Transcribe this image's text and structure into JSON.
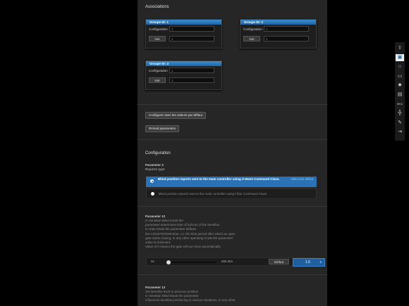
{
  "associations": {
    "title": "Associations",
    "groups": [
      {
        "header": "Groupe ID: 1",
        "config_label": "Configuration",
        "config_value": "1",
        "btn_label": "Voir",
        "btn_value": "1"
      },
      {
        "header": "Groupe ID: 2",
        "config_label": "Configuration",
        "config_value": "1",
        "btn_label": "Voir",
        "btn_value": "1"
      },
      {
        "header": "Groupe ID: 3",
        "config_label": "Configuration",
        "config_value": "1",
        "btn_label": "Voir",
        "btn_value": "1"
      }
    ]
  },
  "actions": {
    "configure_default": "Configurer avec les valeurs par défaut",
    "reload": "Reload parameters"
  },
  "configuration": {
    "title": "Configuration",
    "param3": {
      "title": "Parameter 3",
      "subtitle": "Reports type",
      "options": [
        {
          "label": "Blind position reports sent to the main controller using Z-Wave Command Class.",
          "selected": true,
          "default_note": "Valeur par défaut"
        },
        {
          "label": "Blind position reports sent to the main controller using Fibar Command Class.",
          "selected": false
        }
      ]
    },
    "param12": {
      "title": "Parameter 12",
      "lines": [
        "In Venetian Blind mode the",
        "parameter determines time of full turn of the lamellas.",
        "In Gate Mode the parameter defines",
        "the COUNTDOWN time, i.e. the time period after which an open",
        "gate starts closing. In any other operating mode the parameter",
        "value is irrelevant.",
        "Value of 0 means the gate will not close automatically."
      ],
      "slider": {
        "min_label": "0s",
        "max_label": "655.35s",
        "value_fraction": 0,
        "default_btn": "Défaut",
        "value": "1.5",
        "unit": "s"
      }
    },
    "param13": {
      "title": "Parameter 13",
      "lines": [
        "Set lamellas back to previous position",
        "In Venetian Blind Mode the parameter",
        "influences lamellas positioning in various situations. In any other"
      ]
    }
  },
  "toolbar": {
    "items": [
      {
        "name": "up-arrow-icon",
        "glyph": "⇧",
        "active": false
      },
      {
        "name": "save-icon",
        "glyph": "▣",
        "active": true
      },
      {
        "name": "home-icon",
        "glyph": "⌂",
        "active": false
      },
      {
        "name": "display-icon",
        "glyph": "▭",
        "active": false
      },
      {
        "name": "brightness-icon",
        "glyph": "✹",
        "active": false
      },
      {
        "name": "chat-icon",
        "glyph": "▤",
        "active": false
      },
      {
        "name": "mhz-icon",
        "glyph": "MHz",
        "active": false
      },
      {
        "name": "network-icon",
        "glyph": "╬",
        "active": false
      },
      {
        "name": "edit-icon",
        "glyph": "✎",
        "active": false
      },
      {
        "name": "logout-icon",
        "glyph": "⇥",
        "active": false
      }
    ]
  }
}
